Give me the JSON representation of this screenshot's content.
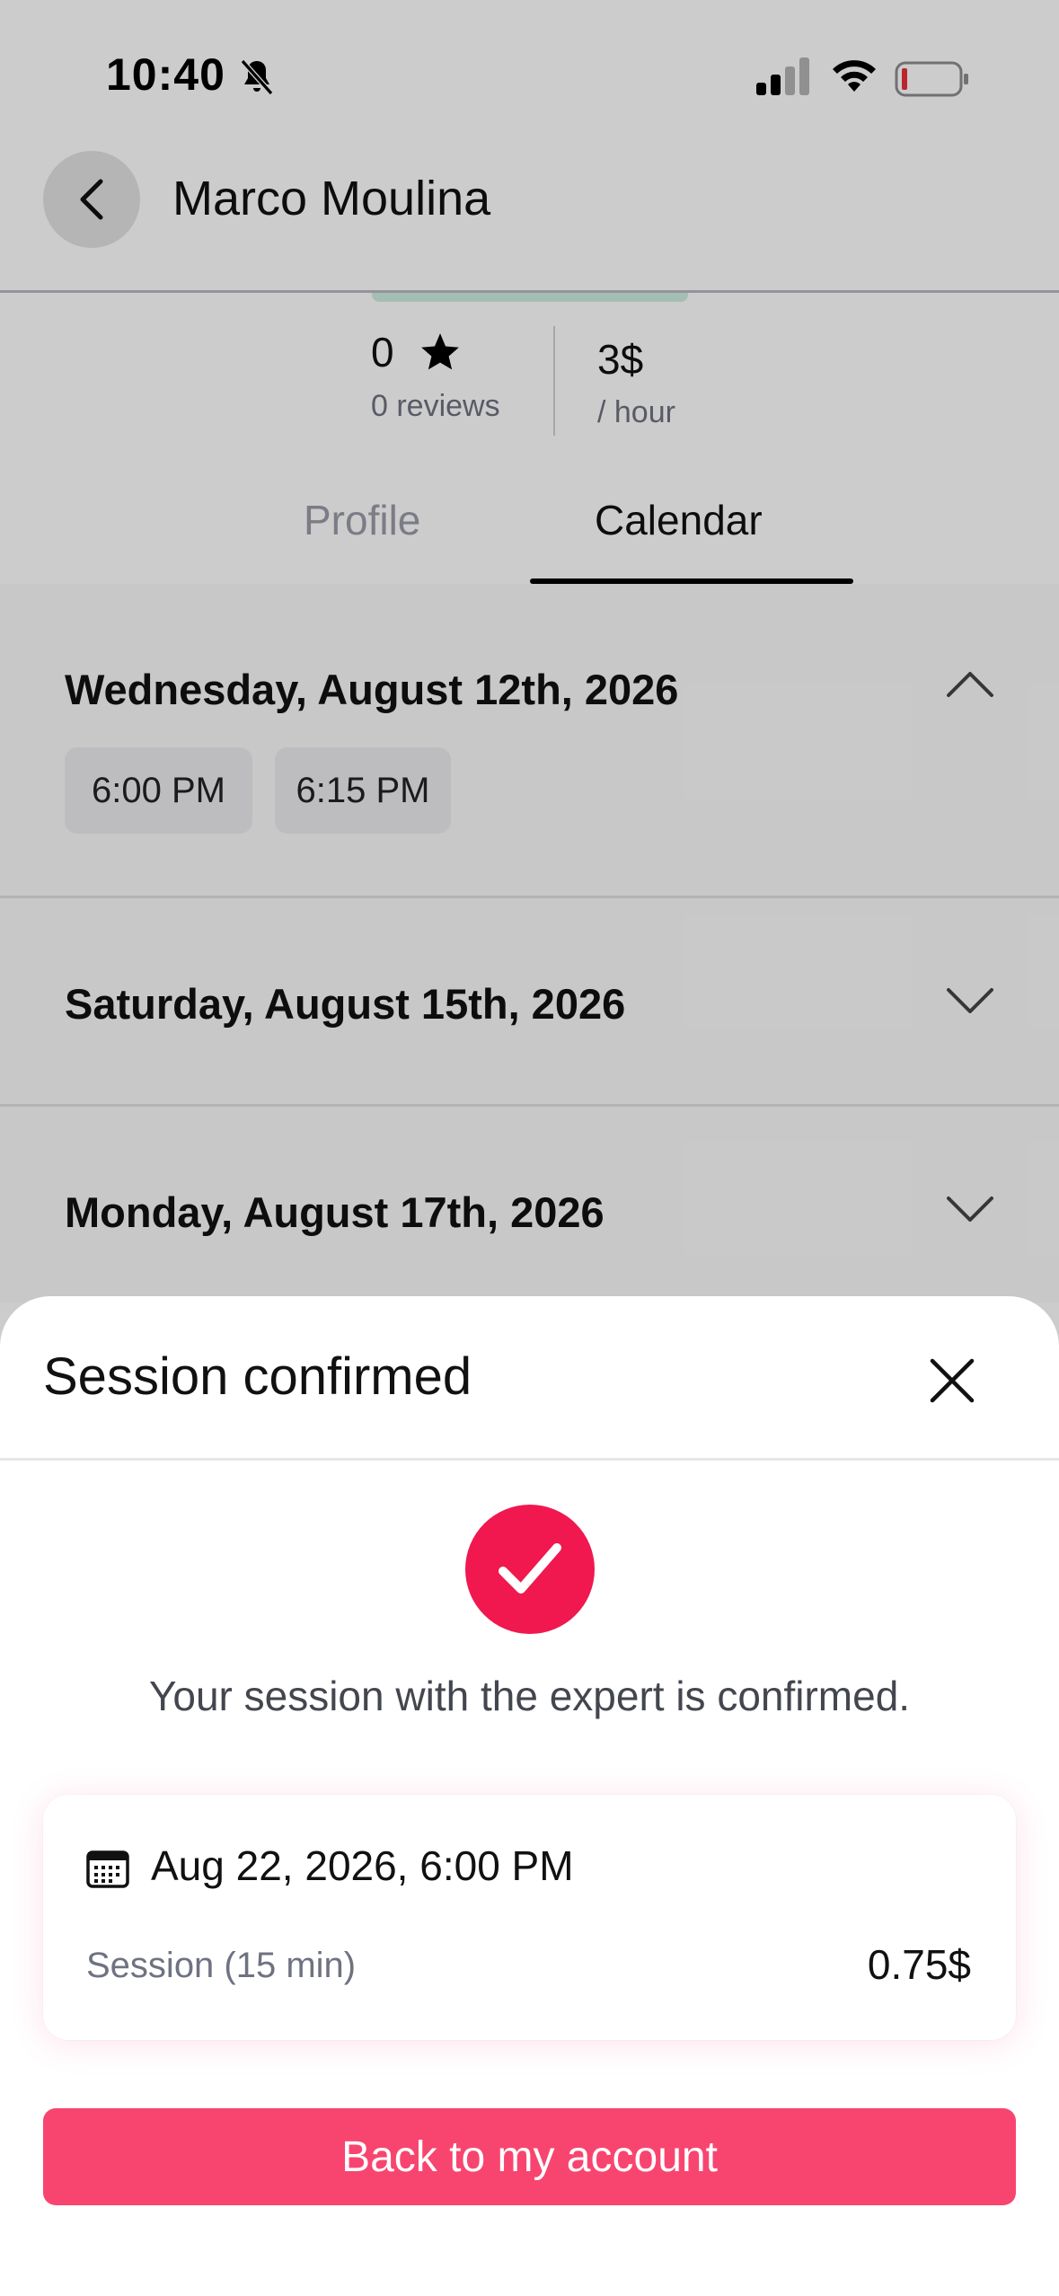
{
  "status_bar": {
    "time": "10:40",
    "icons": [
      "bell-slash-icon",
      "cellular-signal-icon",
      "wifi-icon",
      "battery-low-icon"
    ]
  },
  "header": {
    "title": "Marco Moulina",
    "back_icon": "chevron-left-icon"
  },
  "stats": {
    "rating": "0",
    "reviews": "0 reviews",
    "price": "3$",
    "price_unit": "/ hour"
  },
  "tabs": [
    {
      "label": "Profile",
      "active": false
    },
    {
      "label": "Calendar",
      "active": true
    }
  ],
  "calendar": {
    "days": [
      {
        "title": "Wednesday, August 12th, 2026",
        "expanded": true,
        "slots": [
          "6:00 PM",
          "6:15 PM"
        ]
      },
      {
        "title": "Saturday, August 15th, 2026",
        "expanded": false,
        "slots": []
      },
      {
        "title": "Monday, August 17th, 2026",
        "expanded": false,
        "slots": []
      }
    ]
  },
  "sheet": {
    "title": "Session confirmed",
    "message": "Your session with the expert is confirmed.",
    "session_date": "Aug 22, 2026, 6:00 PM",
    "session_label": "Session (15 min)",
    "session_price": "0.75$",
    "button_label": "Back to my account"
  },
  "colors": {
    "accent": "#f0184f",
    "button": "#f8456f",
    "text_primary": "#111111",
    "text_secondary": "#6f7280"
  }
}
